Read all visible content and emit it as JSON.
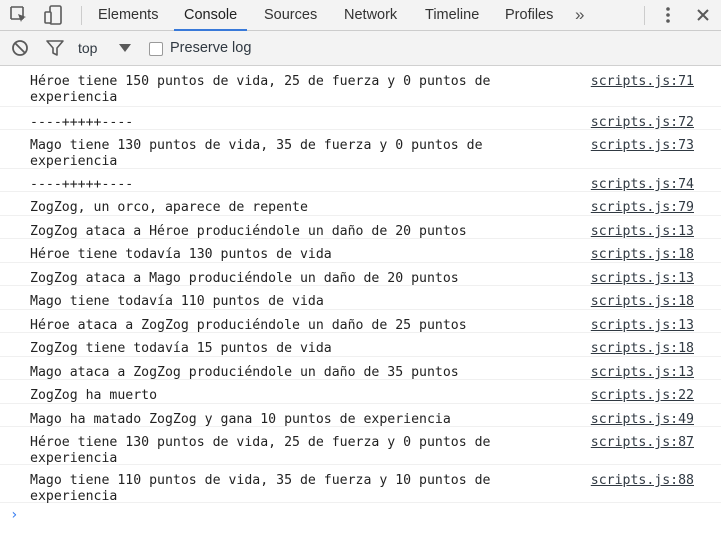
{
  "tabs": [
    "Elements",
    "Console",
    "Sources",
    "Network",
    "Timeline",
    "Profiles"
  ],
  "overflow_glyph": "»",
  "toolbar": {
    "context": "top",
    "preserve_log_label": "Preserve log",
    "preserve_log_checked": false
  },
  "messages": [
    {
      "text": "Héroe tiene 150 puntos de vida, 25 de fuerza y 0 puntos de experiencia",
      "source": "scripts.js:71"
    },
    {
      "text": "----+++++----",
      "source": "scripts.js:72"
    },
    {
      "text": "Mago tiene 130 puntos de vida, 35 de fuerza y 0 puntos de experiencia",
      "source": "scripts.js:73"
    },
    {
      "text": "----+++++----",
      "source": "scripts.js:74"
    },
    {
      "text": "ZogZog, un orco, aparece de repente",
      "source": "scripts.js:79"
    },
    {
      "text": "ZogZog ataca a Héroe produciéndole un daño de 20 puntos",
      "source": "scripts.js:13"
    },
    {
      "text": "Héroe tiene todavía 130 puntos de vida",
      "source": "scripts.js:18"
    },
    {
      "text": "ZogZog ataca a Mago produciéndole un daño de 20 puntos",
      "source": "scripts.js:13"
    },
    {
      "text": "Mago tiene todavía 110 puntos de vida",
      "source": "scripts.js:18"
    },
    {
      "text": "Héroe ataca a ZogZog produciéndole un daño de 25 puntos",
      "source": "scripts.js:13"
    },
    {
      "text": "ZogZog tiene todavía 15 puntos de vida",
      "source": "scripts.js:18"
    },
    {
      "text": "Mago ataca a ZogZog produciéndole un daño de 35 puntos",
      "source": "scripts.js:13"
    },
    {
      "text": "ZogZog ha muerto",
      "source": "scripts.js:22"
    },
    {
      "text": "Mago ha matado ZogZog y gana 10 puntos de experiencia",
      "source": "scripts.js:49"
    },
    {
      "text": "Héroe tiene 130 puntos de vida, 25 de fuerza y 0 puntos de experiencia",
      "source": "scripts.js:87"
    },
    {
      "text": "Mago tiene 110 puntos de vida, 35 de fuerza y 10 puntos de experiencia",
      "source": "scripts.js:88"
    }
  ],
  "prompt_glyph": "›",
  "colors": {
    "accent": "#3879d9",
    "prompt": "#367cf1"
  }
}
